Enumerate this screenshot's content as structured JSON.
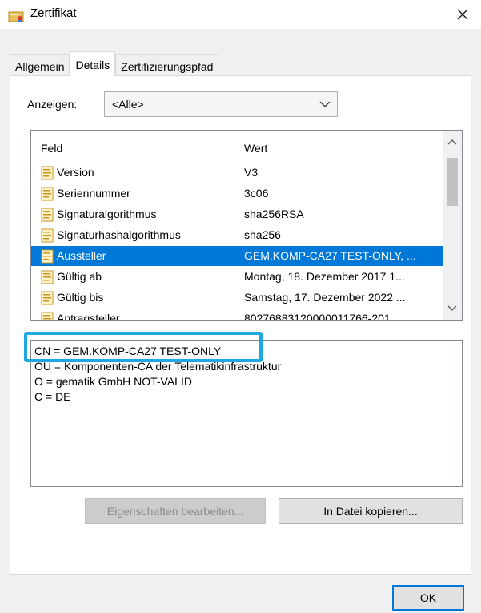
{
  "window": {
    "title": "Zertifikat",
    "icons": {
      "app": "certificate-icon",
      "close": "close-icon"
    }
  },
  "tabs": [
    {
      "label": "Allgemein",
      "active": false
    },
    {
      "label": "Details",
      "active": true
    },
    {
      "label": "Zertifizierungspfad",
      "active": false
    }
  ],
  "show": {
    "label": "Anzeigen:",
    "selected": "<Alle>"
  },
  "list": {
    "headers": {
      "field": "Feld",
      "value": "Wert"
    },
    "rows": [
      {
        "field": "Version",
        "value": "V3"
      },
      {
        "field": "Seriennummer",
        "value": "3c06"
      },
      {
        "field": "Signaturalgorithmus",
        "value": "sha256RSA"
      },
      {
        "field": "Signaturhashalgorithmus",
        "value": "sha256"
      },
      {
        "field": "Aussteller",
        "value": "GEM.KOMP-CA27 TEST-ONLY, ..."
      },
      {
        "field": "Gültig ab",
        "value": "Montag, 18. Dezember 2017 1..."
      },
      {
        "field": "Gültig bis",
        "value": "Samstag, 17. Dezember 2022 ..."
      },
      {
        "field": "Antragsteller",
        "value": "80276883120000011766-201..."
      }
    ],
    "selected_index": 4
  },
  "detail": {
    "lines": [
      "CN = GEM.KOMP-CA27 TEST-ONLY",
      "OU = Komponenten-CA der Telematikinfrastruktur",
      "O = gematik GmbH NOT-VALID",
      "C = DE"
    ]
  },
  "buttons": {
    "edit_properties": "Eigenschaften bearbeiten...",
    "copy_to_file": "In Datei kopieren...",
    "ok": "OK"
  },
  "colors": {
    "selection": "#0078d7",
    "highlight_box": "#1ea7e0",
    "dialog_bg": "#f0f0f0"
  }
}
